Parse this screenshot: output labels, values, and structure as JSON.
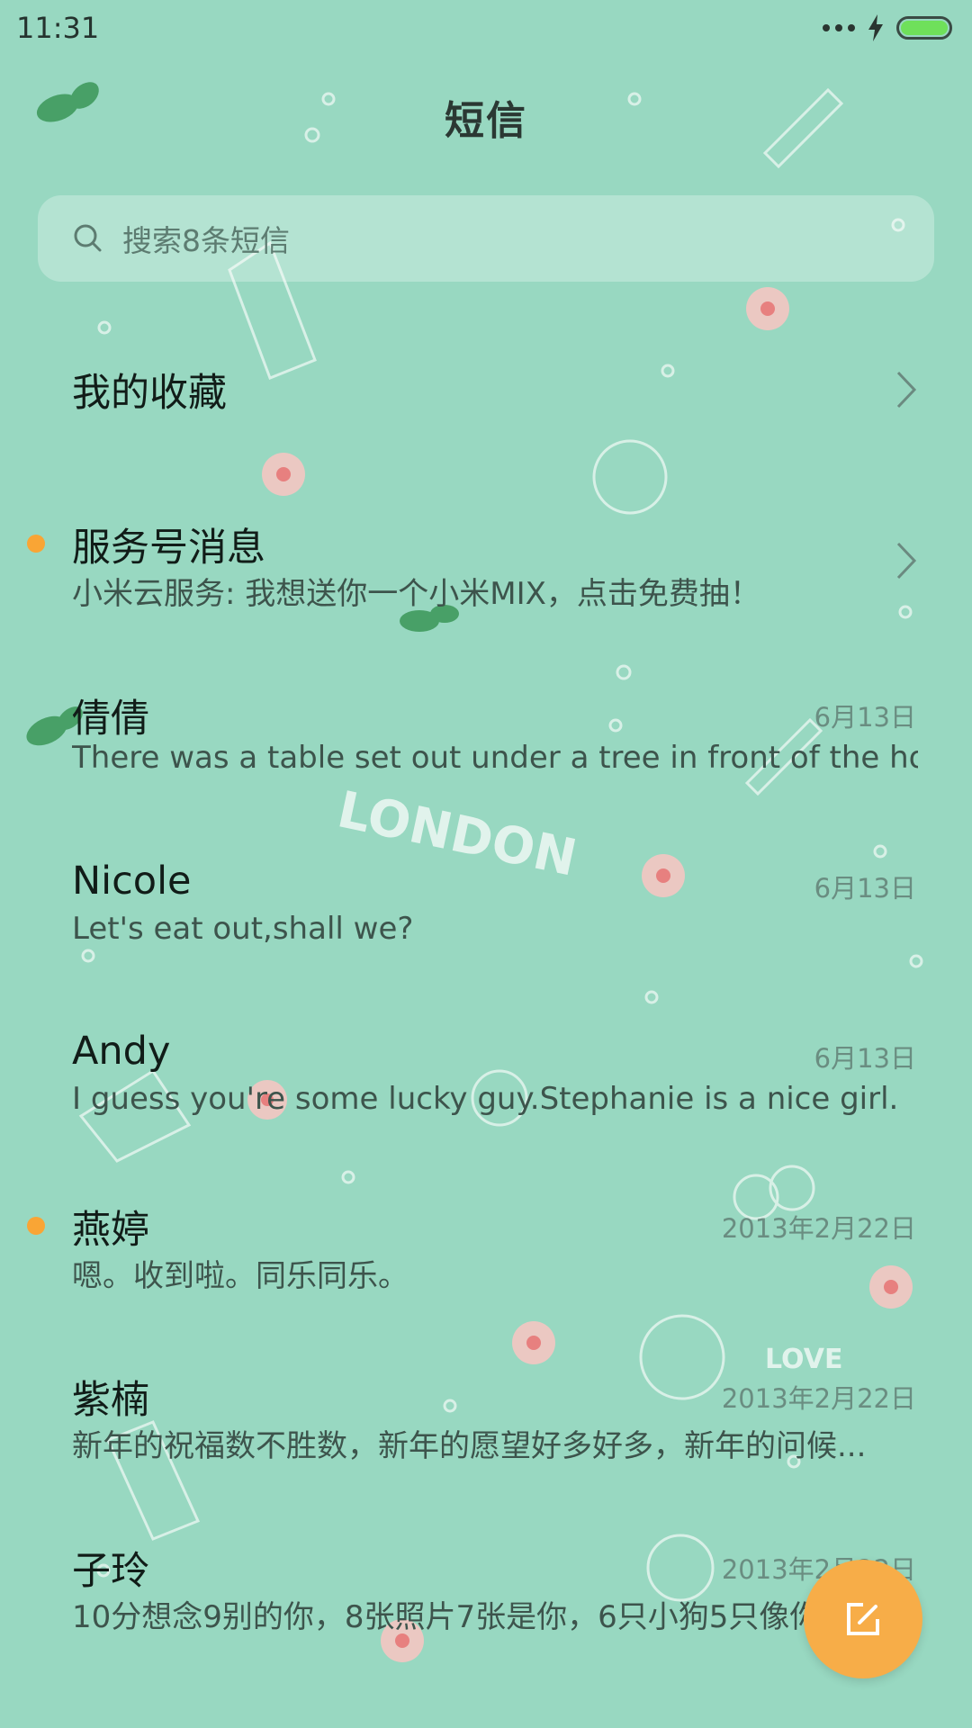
{
  "status_bar": {
    "time": "11:31",
    "icons": [
      "more-dots-icon",
      "charging-bolt-icon",
      "battery-icon"
    ],
    "battery_level": 1.0,
    "battery_color": "#6fe05a"
  },
  "header": {
    "title": "短信"
  },
  "search": {
    "placeholder": "搜索8条短信",
    "icon": "search-icon"
  },
  "favorites": {
    "label": "我的收藏"
  },
  "conversations": [
    {
      "name": "服务号消息",
      "preview": "小米云服务: 我想送你一个小米MIX，点击免费抽！",
      "date": "",
      "unread": true,
      "chevron": true
    },
    {
      "name": "倩倩",
      "preview": "There was a table set out under a tree in front of the ho...",
      "date": "6月13日",
      "unread": false
    },
    {
      "name": "Nicole",
      "preview": "Let's eat out,shall we?",
      "date": "6月13日",
      "unread": false
    },
    {
      "name": "Andy",
      "preview": "I guess you're some lucky guy.Stephanie is a nice girl.",
      "date": "6月13日",
      "unread": false
    },
    {
      "name": "燕婷",
      "preview": "嗯。收到啦。同乐同乐。",
      "date": "2013年2月22日",
      "unread": true
    },
    {
      "name": "紫楠",
      "preview": "新年的祝福数不胜数，新年的愿望好多好多，新年的问候...",
      "date": "2013年2月22日",
      "unread": false
    },
    {
      "name": "子玲",
      "preview": "10分想念9别的你，8张照片7张是你，6只小狗5只像你",
      "date": "2013年2月22日",
      "unread": false
    }
  ],
  "fab": {
    "icon": "compose-icon"
  },
  "colors": {
    "background": "#98d8c1",
    "accent": "#f7ad48",
    "unread_dot": "#f9a535"
  }
}
